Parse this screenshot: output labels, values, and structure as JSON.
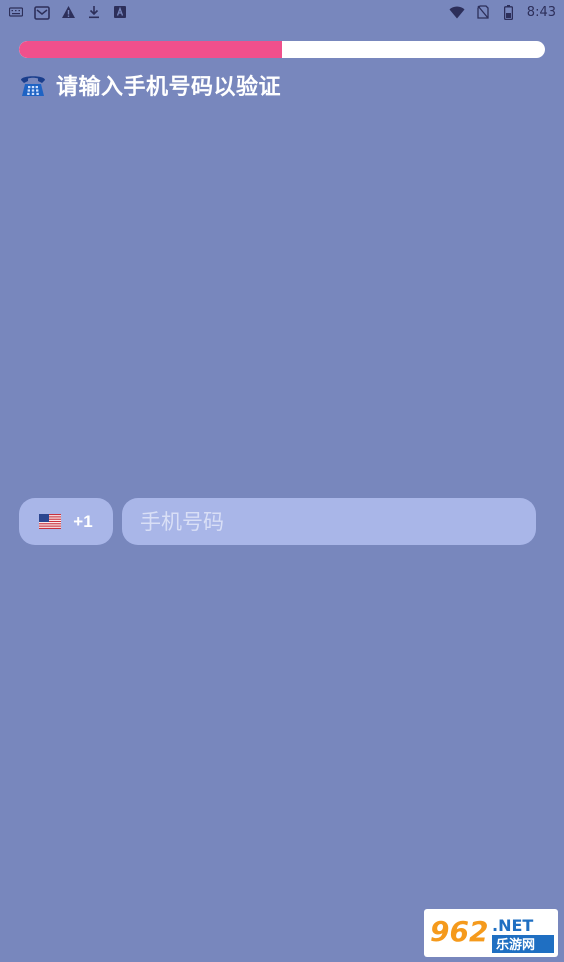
{
  "status_bar": {
    "time": "8:43",
    "left_icons": [
      "keyboard-icon",
      "mail-icon",
      "warning-icon",
      "download-icon",
      "translate-icon"
    ],
    "right_icons": [
      "wifi-icon",
      "no-sim-icon",
      "battery-icon"
    ]
  },
  "progress": {
    "value_percent": 50,
    "fill_color": "#f0508c",
    "track_color": "#ffffff"
  },
  "header": {
    "icon": "telephone-icon",
    "title": "请输入手机号码以验证"
  },
  "phone_form": {
    "country_flag": "us-flag-icon",
    "country_code": "+1",
    "placeholder": "手机号码"
  },
  "watermark": {
    "number": "962",
    "suffix": ".NET",
    "caption": "乐游网"
  },
  "colors": {
    "background": "#7887bd",
    "field": "#a9b6e8",
    "accent": "#f0508c"
  }
}
